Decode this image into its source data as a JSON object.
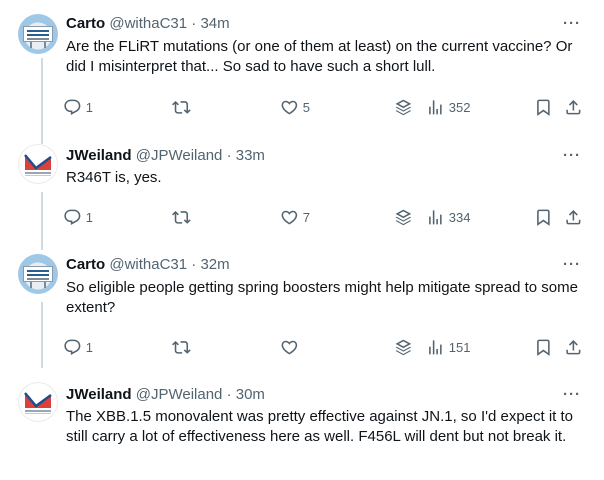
{
  "tweets": [
    {
      "author": "Carto",
      "handle": "@withaC31",
      "separator": "·",
      "time": "34m",
      "text": "Are the FLiRT mutations (or one of them at least) on the current vaccine? Or did I misinterpret that... So sad to have such a short lull.",
      "replies": "1",
      "retweets": "",
      "likes": "5",
      "views": "352",
      "avatar_icon": "billboard-avatar"
    },
    {
      "author": "JWeiland",
      "handle": "@JPWeiland",
      "separator": "·",
      "time": "33m",
      "text": "R346T is, yes.",
      "replies": "1",
      "retweets": "",
      "likes": "7",
      "views": "334",
      "avatar_icon": "chart-avatar"
    },
    {
      "author": "Carto",
      "handle": "@withaC31",
      "separator": "·",
      "time": "32m",
      "text": "So eligible people getting spring boosters might help mitigate spread to some extent?",
      "replies": "1",
      "retweets": "",
      "likes": "",
      "views": "151",
      "avatar_icon": "billboard-avatar"
    },
    {
      "author": "JWeiland",
      "handle": "@JPWeiland",
      "separator": "·",
      "time": "30m",
      "text": "The XBB.1.5 monovalent was pretty effective against JN.1, so I'd expect it to still carry a lot of effectiveness here as well.  F456L will dent but not break it.",
      "avatar_icon": "chart-avatar"
    }
  ],
  "colors": {
    "text": "#0f1419",
    "secondary": "#536471",
    "thread_line": "#cfd9de",
    "avatar_red": "#d8413c",
    "avatar_blue": "#1f4e8c"
  }
}
